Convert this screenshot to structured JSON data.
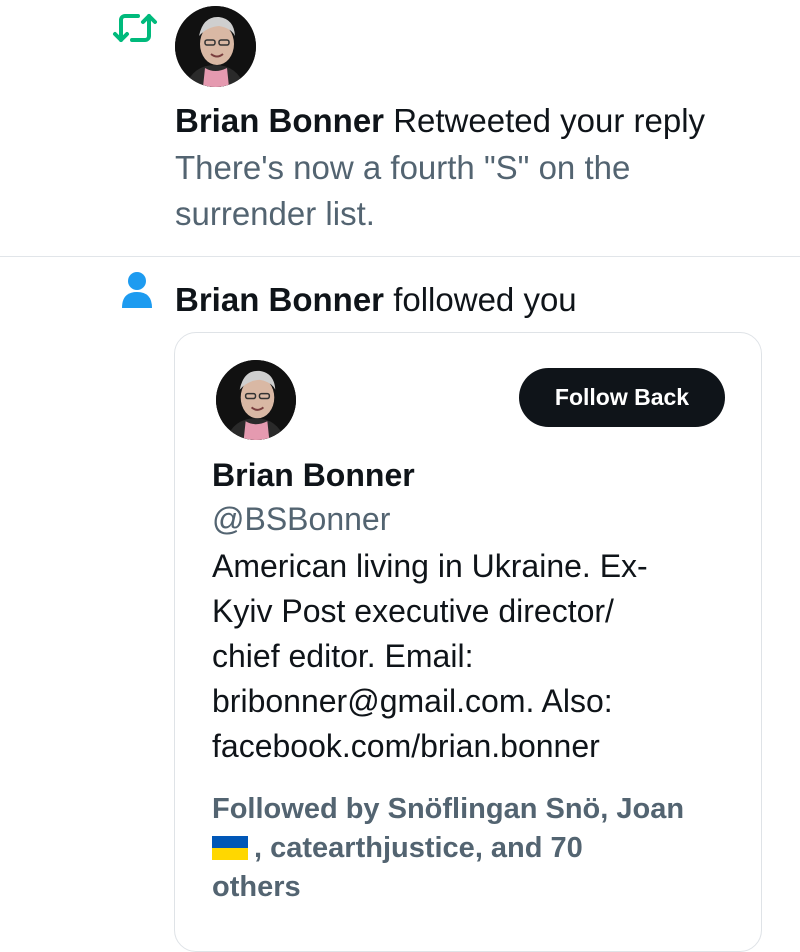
{
  "retweet_notification": {
    "icon": "retweet-icon",
    "avatar_alt": "Brian Bonner avatar",
    "user_name": "Brian Bonner",
    "action_text": "Retweeted your reply",
    "tweet_text_line1": "There's now a fourth \"S\" on the",
    "tweet_text_line2": "surrender list."
  },
  "follow_notification": {
    "icon": "person-icon",
    "user_name": "Brian Bonner",
    "action_text": "followed you",
    "card": {
      "name": "Brian Bonner",
      "handle": "@BSBonner",
      "follow_button_label": "Follow Back",
      "bio": "American living in Ukraine. Ex-\nKyiv Post executive director/\nchief editor. Email:\nbribonner@gmail.com. Also:\nfacebook.com/brian.bonner",
      "followed_by_prefix": "Followed by Snöflingan Snö, Joan",
      "followed_by_rest": ", catearthjustice, and 70",
      "followed_by_end": "others"
    }
  },
  "colors": {
    "retweet_green": "#00ba7c",
    "person_blue": "#1d9bf0",
    "button_bg": "#0f1419",
    "muted_text": "#536471",
    "flag_blue": "#0057b7",
    "flag_yellow": "#ffd700"
  }
}
